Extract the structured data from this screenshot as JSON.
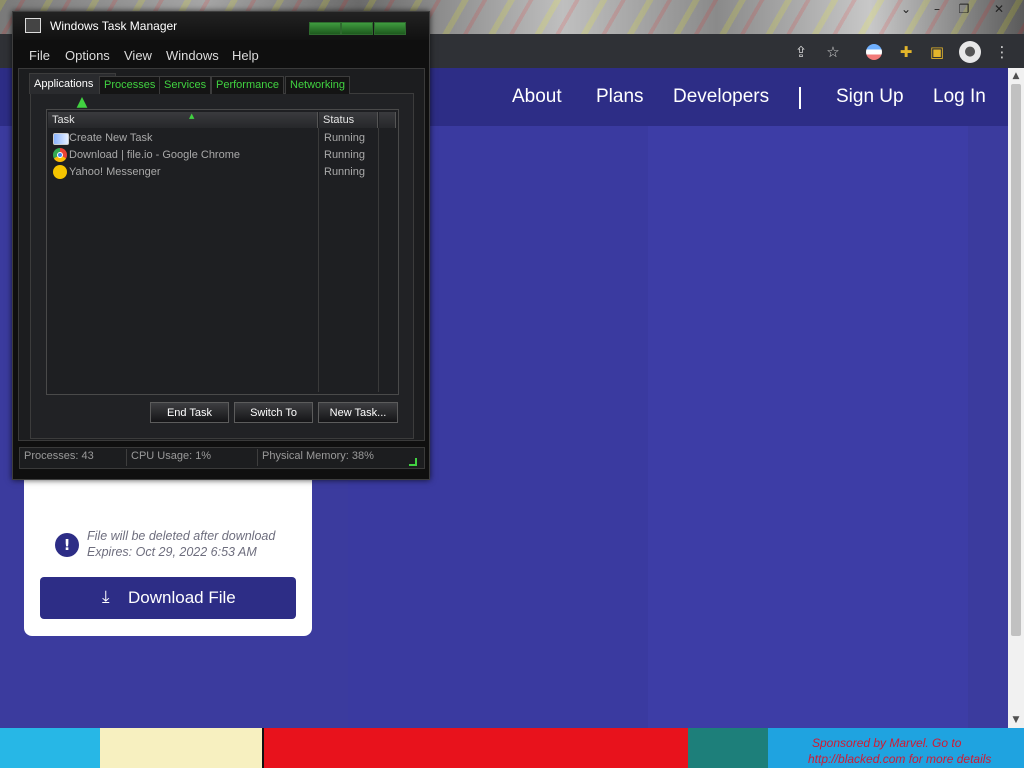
{
  "browser": {
    "window_controls": [
      "⌄",
      "–",
      "❐",
      "✕"
    ],
    "toolbar_icons": [
      "share-icon",
      "star-icon",
      "flag-avatar-icon",
      "extensions-icon",
      "side-panel-icon",
      "profile-icon",
      "menu-icon"
    ]
  },
  "site": {
    "nav": {
      "about": "About",
      "plans": "Plans",
      "developers": "Developers",
      "sign_up": "Sign Up",
      "log_in": "Log In"
    },
    "card": {
      "info_line1": "File will be deleted after download",
      "info_line2": "Expires: Oct 29, 2022 6:53 AM",
      "download_label": "Download File"
    },
    "colors": {
      "brand": "#2d2d86",
      "background": "#3b3b9e"
    }
  },
  "ad": {
    "line1": "Sponsored by Marvel. Go to",
    "line2": "http://blacked.com for more details"
  },
  "task_manager": {
    "title": "Windows Task Manager",
    "menu": [
      "File",
      "Options",
      "View",
      "Windows",
      "Help"
    ],
    "tabs": [
      "Applications",
      "Processes",
      "Services",
      "Performance",
      "Networking"
    ],
    "active_tab": "Applications",
    "columns": {
      "task": "Task",
      "status": "Status"
    },
    "rows": [
      {
        "task": "Create New Task",
        "status": "Running",
        "icon": "task-icon"
      },
      {
        "task": "Download | file.io - Google Chrome",
        "status": "Running",
        "icon": "chrome-icon"
      },
      {
        "task": "Yahoo! Messenger",
        "status": "Running",
        "icon": "yahoo-messenger-icon"
      }
    ],
    "buttons": {
      "end_task": "End Task",
      "switch_to": "Switch To",
      "new_task": "New Task..."
    },
    "status": {
      "processes": "Processes: 43",
      "cpu": "CPU Usage: 1%",
      "memory": "Physical Memory: 38%"
    },
    "theme_color": "#41d241"
  }
}
